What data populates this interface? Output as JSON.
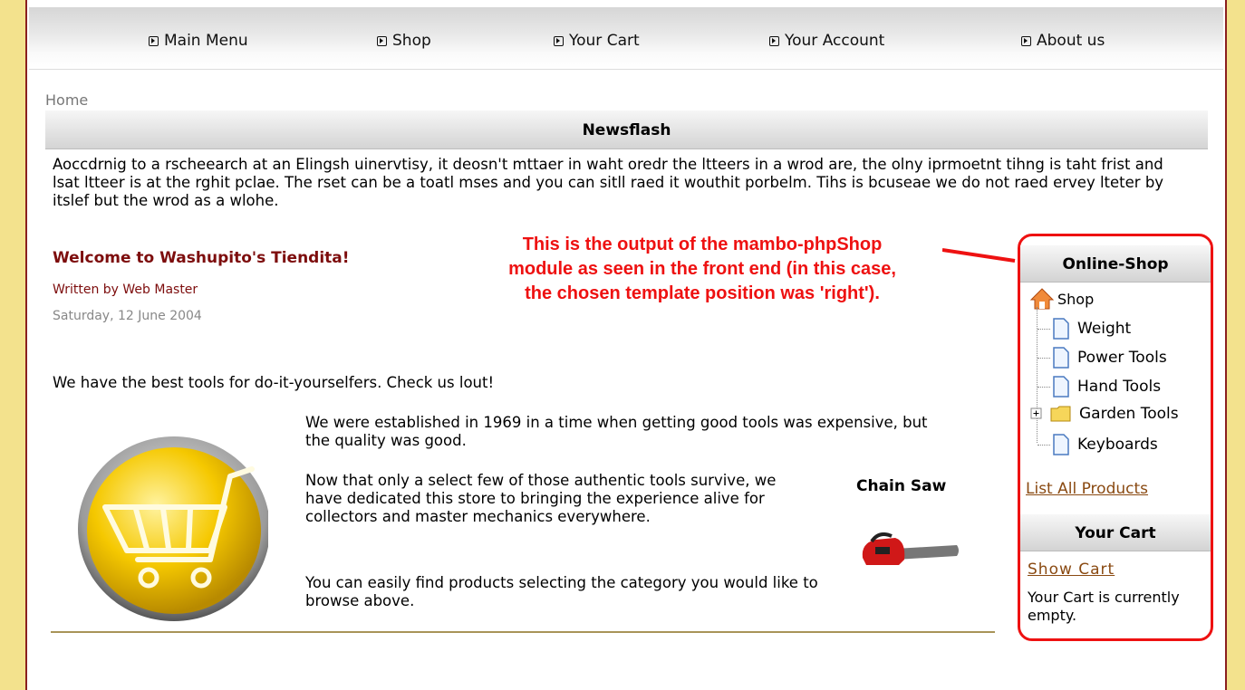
{
  "nav": {
    "items": [
      {
        "label": "Main Menu"
      },
      {
        "label": "Shop"
      },
      {
        "label": "Your Cart"
      },
      {
        "label": "Your Account"
      },
      {
        "label": "About us"
      }
    ]
  },
  "breadcrumb": "Home",
  "newsflash": {
    "title": "Newsflash",
    "text": "Aoccdrnig to a rscheearch at an Elingsh uinervtisy, it deosn't mttaer in waht oredr the ltteers in a wrod are, the olny iprmoetnt tihng is taht frist and lsat ltteer is at the rghit pclae. The rset can be a toatl mses and you can sitll raed it wouthit porbelm. Tihs is bcuseae we do not raed ervey lteter by itslef but the wrod as a wlohe."
  },
  "article": {
    "title": "Welcome to Washupito's Tiendita!",
    "author": "Written by Web Master",
    "date": "Saturday, 12 June 2004",
    "intro": "We have the best tools for do-it-yourselfers. Check us lout!",
    "p1": "We were established in 1969 in a time when getting good tools was expensive, but the quality was good.",
    "p2": "Now that only a select few of those authentic tools survive, we have dedicated this store to bringing the experience alive for collectors and master mechanics everywhere.",
    "p3": "You can easily find products selecting the category you would like to browse above.",
    "product_label": "Chain Saw"
  },
  "annotation": {
    "line1": "This is the output of the mambo-phpShop",
    "line2": "module as seen in the front end (in this case,",
    "line3": "the chosen template position was 'right')."
  },
  "shop_module": {
    "title": "Online-Shop",
    "root": "Shop",
    "categories": [
      {
        "label": "Weight",
        "icon": "page-icon"
      },
      {
        "label": "Power Tools",
        "icon": "page-icon"
      },
      {
        "label": "Hand Tools",
        "icon": "page-icon"
      },
      {
        "label": "Garden Tools",
        "icon": "folder-icon"
      },
      {
        "label": "Keyboards",
        "icon": "page-icon"
      }
    ],
    "list_all": "List All Products",
    "cart_title": "Your Cart",
    "show_cart": "Show Cart",
    "cart_status": "Your Cart is currently empty."
  },
  "colors": {
    "background": "#f3e28d",
    "border": "#8a1f1f",
    "annotation": "#ee1111",
    "article_title": "#7d0d0d",
    "link": "#8a4a12"
  }
}
